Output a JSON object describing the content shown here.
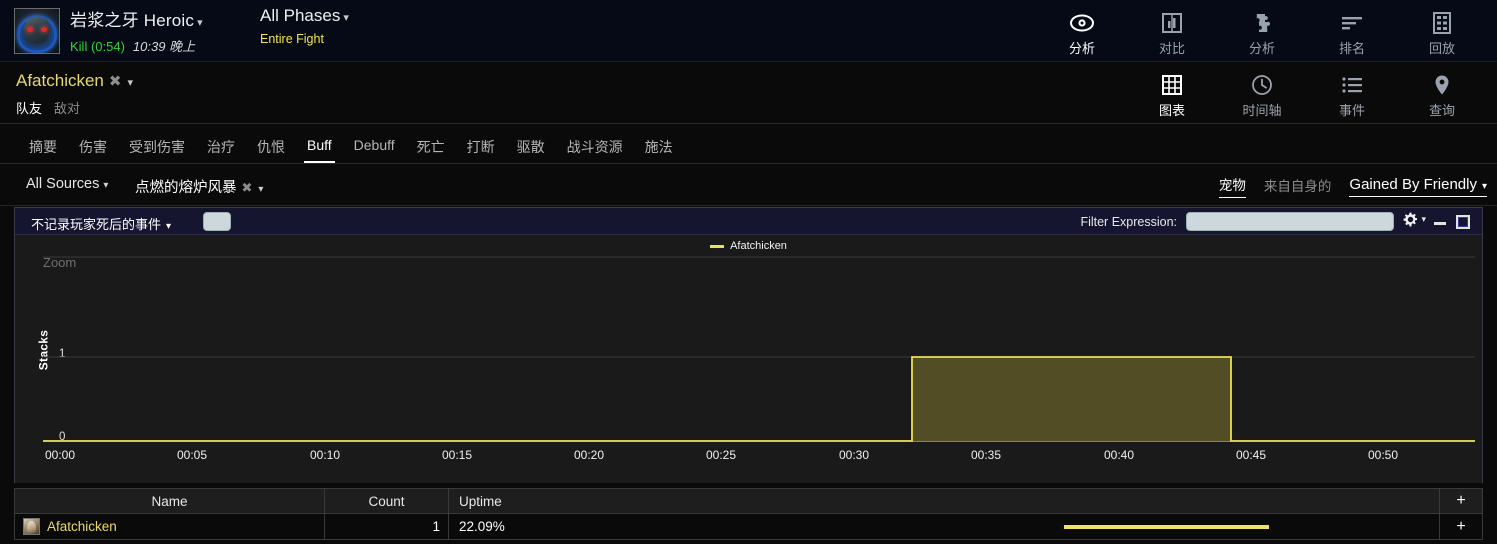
{
  "header": {
    "boss_icon_name": "boss-portrait-icon",
    "encounter_title": "岩浆之牙 Heroic",
    "caret": "▾",
    "kill_label": "Kill (0:54)",
    "encounter_time": "10:39 晚上",
    "phase_title": "All Phases",
    "phase_sub": "Entire Fight",
    "primary_nav": [
      {
        "label": "分析",
        "icon": "eye-icon",
        "active": true
      },
      {
        "label": "对比",
        "icon": "compare-icon",
        "active": false
      },
      {
        "label": "分析",
        "icon": "puzzle-icon",
        "active": false
      },
      {
        "label": "排名",
        "icon": "ranking-bars-icon",
        "active": false
      },
      {
        "label": "回放",
        "icon": "film-strip-icon",
        "active": false
      }
    ],
    "secondary_nav": [
      {
        "label": "图表",
        "icon": "grid-icon",
        "active": true
      },
      {
        "label": "时间轴",
        "icon": "clock-icon",
        "active": false
      },
      {
        "label": "事件",
        "icon": "list-icon",
        "active": false
      },
      {
        "label": "查询",
        "icon": "map-pin-icon",
        "active": false
      }
    ]
  },
  "player": {
    "name": "Afatchicken",
    "close_glyph": "✖",
    "caret": "▾",
    "friendly_label": "队友",
    "enemy_label": "敌对"
  },
  "tabs": [
    {
      "label": "摘要",
      "active": false
    },
    {
      "label": "伤害",
      "active": false
    },
    {
      "label": "受到伤害",
      "active": false
    },
    {
      "label": "治疗",
      "active": false
    },
    {
      "label": "仇恨",
      "active": false
    },
    {
      "label": "Buff",
      "active": true
    },
    {
      "label": "Debuff",
      "active": false
    },
    {
      "label": "死亡",
      "active": false
    },
    {
      "label": "打断",
      "active": false
    },
    {
      "label": "驱散",
      "active": false
    },
    {
      "label": "战斗资源",
      "active": false
    },
    {
      "label": "施法",
      "active": false
    }
  ],
  "filters": {
    "source_select": "All Sources",
    "ability_select": "点燃的熔炉风暴",
    "ability_close": "✖",
    "caret": "▾",
    "toggle_pets": "宠物",
    "toggle_self": "来自自身的",
    "gained_by": "Gained By Friendly"
  },
  "panel": {
    "death_filter": "不记录玩家死后的事件",
    "filter_expression_label": "Filter Expression:",
    "filter_expression_value": "",
    "filter_expression_placeholder": "",
    "gear_icon": "gear-icon",
    "minimize_icon": "minimize-icon",
    "maximize_icon": "maximize-icon",
    "zoom_label": "Zoom"
  },
  "chart_data": {
    "type": "area",
    "title": "",
    "subtitle": "",
    "xlabel": "",
    "ylabel": "Stacks",
    "legend": [
      "Afatchicken"
    ],
    "legend_position": "top-center",
    "grid": true,
    "ylim": [
      0,
      1
    ],
    "yticks": [
      "0",
      "1"
    ],
    "xlim": [
      "00:00",
      "00:54"
    ],
    "xticks": [
      "00:00",
      "00:05",
      "00:10",
      "00:15",
      "00:20",
      "00:25",
      "00:30",
      "00:35",
      "00:40",
      "00:45",
      "00:50"
    ],
    "series": [
      {
        "name": "Afatchicken",
        "color": "#e8e05a",
        "fill": "#565026",
        "step": true,
        "points": [
          {
            "x": "00:00",
            "y": 0
          },
          {
            "x": "00:32.8",
            "y": 0
          },
          {
            "x": "00:32.8",
            "y": 1
          },
          {
            "x": "00:44.7",
            "y": 1
          },
          {
            "x": "00:44.7",
            "y": 0
          },
          {
            "x": "00:54",
            "y": 0
          }
        ]
      }
    ]
  },
  "table": {
    "columns": [
      "Name",
      "Count",
      "",
      "Uptime",
      "+"
    ],
    "headers": {
      "name": "Name",
      "count": "Count",
      "uptime": "Uptime",
      "plus": "+"
    },
    "rows": [
      {
        "icon": "ability-icon",
        "name": "Afatchicken",
        "count": "1",
        "percent": "22.09%",
        "uptime_bar_pct": 22.09,
        "plus": "+"
      }
    ]
  }
}
